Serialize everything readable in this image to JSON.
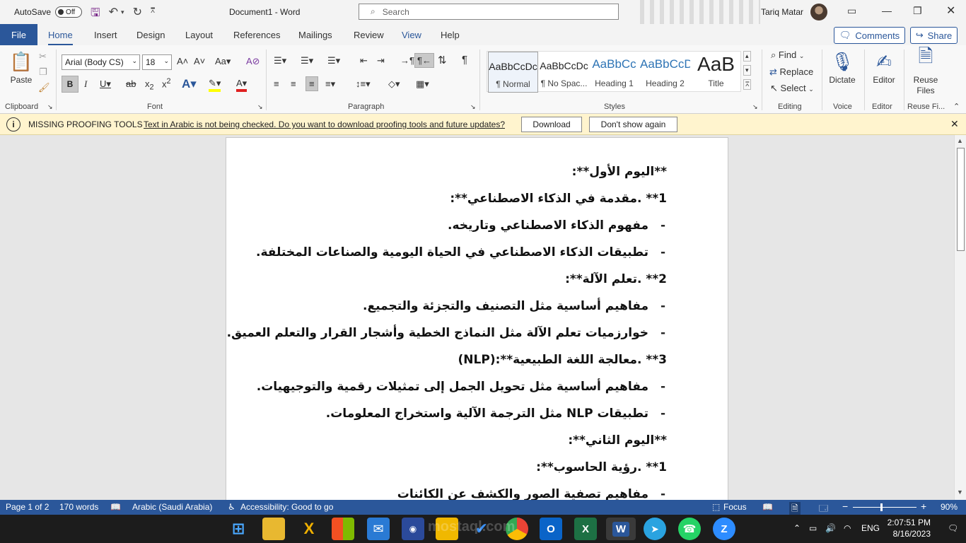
{
  "titlebar": {
    "autosave_label": "AutoSave",
    "autosave_state": "Off",
    "doc_title": "Document1  -  Word",
    "search_placeholder": "Search",
    "user_name": "Tariq Matar"
  },
  "menu": {
    "file": "File",
    "tabs": [
      "Home",
      "Insert",
      "Design",
      "Layout",
      "References",
      "Mailings",
      "Review",
      "View",
      "Help"
    ],
    "active_tab": "Home",
    "comments": "Comments",
    "share": "Share"
  },
  "ribbon": {
    "clipboard": {
      "paste": "Paste",
      "label": "Clipboard"
    },
    "font": {
      "name": "Arial (Body CS)",
      "size": "18",
      "label": "Font"
    },
    "paragraph": {
      "label": "Paragraph"
    },
    "styles": {
      "label": "Styles",
      "items": [
        {
          "preview": "AaBbCcDc",
          "name": "¶ Normal"
        },
        {
          "preview": "AaBbCcDc",
          "name": "¶ No Spac..."
        },
        {
          "preview": "AaBbCc",
          "name": "Heading 1"
        },
        {
          "preview": "AaBbCcD",
          "name": "Heading 2"
        },
        {
          "preview": "AaB",
          "name": "Title"
        }
      ]
    },
    "editing": {
      "find": "Find",
      "replace": "Replace",
      "select": "Select",
      "label": "Editing"
    },
    "voice": {
      "dictate": "Dictate",
      "label": "Voice"
    },
    "editor": {
      "editor": "Editor",
      "label": "Editor"
    },
    "reuse": {
      "button": "Reuse Files",
      "label": "Reuse Fi..."
    }
  },
  "message_bar": {
    "title": "MISSING PROOFING TOOLS",
    "text": "Text in Arabic is not being checked. Do you want to download proofing tools and future updates?",
    "download": "Download",
    "dont_show": "Don't show again"
  },
  "document": {
    "lines": [
      {
        "text": "**اليوم الأول**:",
        "bullet": false
      },
      {
        "text": "1** .مقدمة في الذكاء الاصطناعي**:",
        "bullet": false
      },
      {
        "text": "مفهوم الذكاء الاصطناعي وتاريخه.",
        "bullet": true
      },
      {
        "text": "تطبيقات الذكاء الاصطناعي في الحياة اليومية والصناعات المختلفة.",
        "bullet": true
      },
      {
        "text": "2** .تعلم الآلة**:",
        "bullet": false
      },
      {
        "text": "مفاهيم أساسية مثل التصنيف والتجزئة والتجميع.",
        "bullet": true
      },
      {
        "text": "خوارزميات تعلم الآلة مثل النماذج الخطية وأشجار القرار والتعلم العميق.",
        "bullet": true
      },
      {
        "text": "3** .معالجة اللغة الطبيعية**:(NLP)",
        "bullet": false
      },
      {
        "text": "مفاهيم أساسية مثل تحويل الجمل إلى تمثيلات رقمية والتوجيهيات.",
        "bullet": true
      },
      {
        "text": "تطبيقات NLP مثل الترجمة الآلية واستخراج المعلومات.",
        "bullet": true
      },
      {
        "text": "**اليوم الثاني**:",
        "bullet": false
      },
      {
        "text": "1** .رؤية الحاسوب**:",
        "bullet": false
      },
      {
        "text": "مفاهيم تصفية الصور والكشف عن الكائنات",
        "bullet": true
      }
    ],
    "bullet_char": "-"
  },
  "status": {
    "page": "Page 1 of 2",
    "words": "170 words",
    "language": "Arabic (Saudi Arabia)",
    "accessibility": "Accessibility: Good to go",
    "focus": "Focus",
    "zoom": "90%",
    "zoom_level": 0.9
  },
  "taskbar": {
    "lang": "ENG",
    "time": "2:07:51 PM",
    "date": "8/16/2023",
    "watermark": "mostaql.com"
  },
  "colors": {
    "word_blue": "#2b579a",
    "message_bar": "#fff4ce",
    "taskbar": "#1c1c1c"
  }
}
